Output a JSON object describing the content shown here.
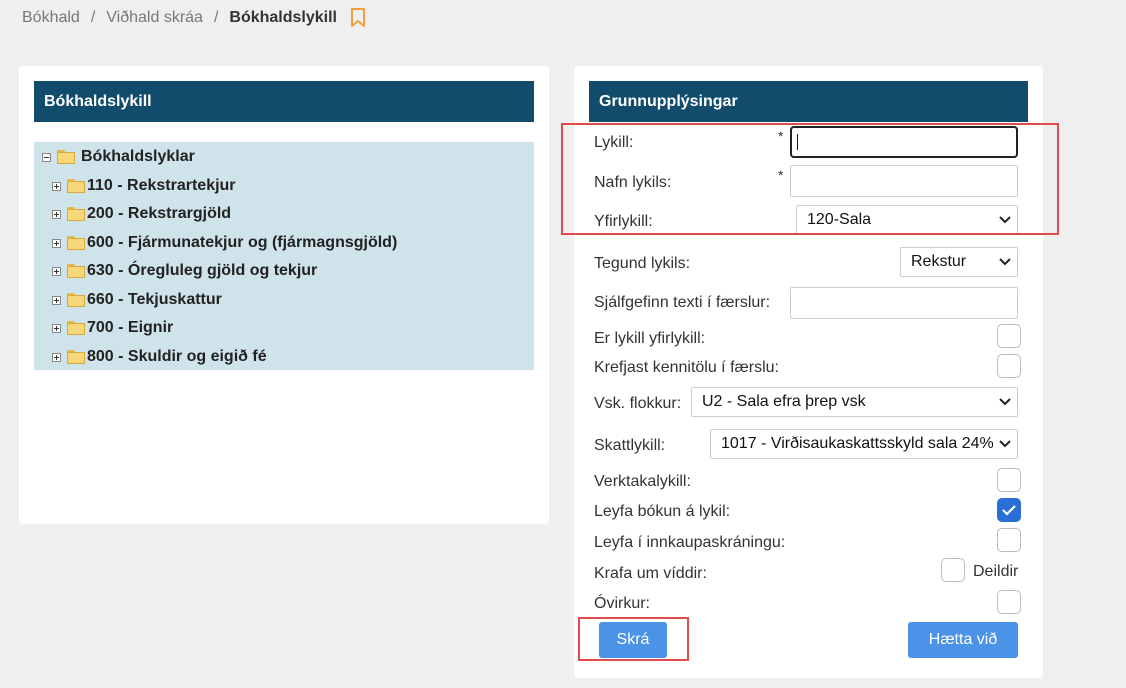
{
  "breadcrumb": {
    "items": [
      "Bókhald",
      "Viðhald skráa"
    ],
    "separator": "/",
    "current": "Bókhaldslykill",
    "bookmark_icon": "bookmark-icon",
    "bookmark_color": "#f0a040"
  },
  "left_panel": {
    "title": "Bókhaldslykill",
    "tree": {
      "root": "Bókhaldslyklar",
      "children": [
        "110 - Rekstrartekjur",
        "200 - Rekstrargjöld",
        "600 - Fjármunatekjur og (fjármagnsgjöld)",
        "630 - Óregluleg gjöld og tekjur",
        "660 - Tekjuskattur",
        "700 - Eignir",
        "800 - Skuldir og eigið fé"
      ]
    }
  },
  "right_panel": {
    "title": "Grunnupplýsingar",
    "lykill": {
      "label": "Lykill:",
      "value": "",
      "required": "*"
    },
    "nafn_lykils": {
      "label": "Nafn lykils:",
      "value": "",
      "required": "*"
    },
    "yfirlykill": {
      "label": "Yfirlykill:",
      "value": "120-Sala"
    },
    "tegund_lykils": {
      "label": "Tegund lykils:",
      "value": "Rekstur"
    },
    "sjalfgefinn_texti": {
      "label": "Sjálfgefinn texti í færslur:",
      "value": ""
    },
    "er_lykill_yfirlykill": {
      "label": "Er lykill yfirlykill:",
      "checked": false
    },
    "krefjast_kennitolu": {
      "label": "Krefjast kennitölu í færslu:",
      "checked": false
    },
    "vsk_flokkur": {
      "label": "Vsk. flokkur:",
      "value": "U2 - Sala efra þrep vsk"
    },
    "skattlykill": {
      "label": "Skattlykill:",
      "value": "1017 - Virðisaukaskattsskyld sala 24%"
    },
    "verktakalykill": {
      "label": "Verktakalykill:",
      "checked": false
    },
    "leyfa_bokun": {
      "label": "Leyfa bókun á lykil:",
      "checked": true
    },
    "leyfa_innkaup": {
      "label": "Leyfa í innkaupaskráningu:",
      "checked": false
    },
    "krafa_um_viddir": {
      "label": "Krafa um víddir:",
      "checkbox_label": "Deildir",
      "checked": false
    },
    "ovirkur": {
      "label": "Óvirkur:",
      "checked": false
    },
    "buttons": {
      "save": "Skrá",
      "cancel": "Hætta við"
    }
  },
  "colors": {
    "header_bg": "#124c6d",
    "tree_bg": "#cfe3ea",
    "button_bg": "#4a93e6",
    "checkbox_checked": "#2a6fd6",
    "highlight": "#e04b4b"
  }
}
